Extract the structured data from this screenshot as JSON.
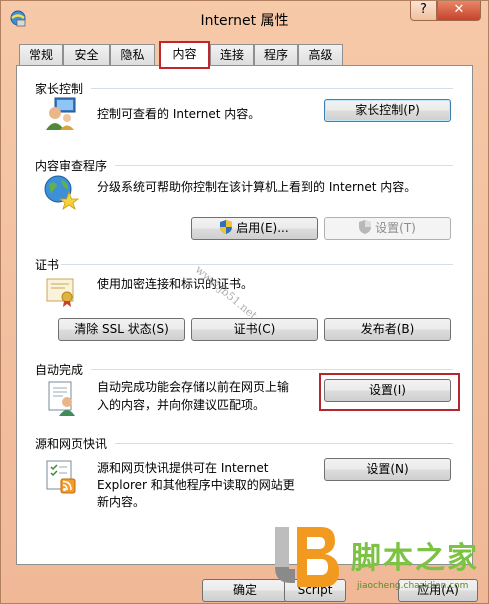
{
  "window": {
    "title": "Internet 属性",
    "help_label": "?",
    "close_label": "✕"
  },
  "tabs": [
    {
      "label": "常规"
    },
    {
      "label": "安全"
    },
    {
      "label": "隐私"
    },
    {
      "label": "内容",
      "active": true
    },
    {
      "label": "连接"
    },
    {
      "label": "程序"
    },
    {
      "label": "高级"
    }
  ],
  "parental": {
    "title": "家长控制",
    "desc": "控制可查看的 Internet 内容。",
    "button": "家长控制(P)"
  },
  "advisor": {
    "title": "内容审查程序",
    "desc": "分级系统可帮助你控制在该计算机上看到的 Internet 内容。",
    "enable_button": "启用(E)...",
    "settings_button": "设置(T)"
  },
  "certificates": {
    "title": "证书",
    "desc": "使用加密连接和标识的证书。",
    "clear_ssl_button": "清除 SSL 状态(S)",
    "cert_button": "证书(C)",
    "publishers_button": "发布者(B)"
  },
  "autocomplete": {
    "title": "自动完成",
    "desc_line1": "自动完成功能会存储以前在网页上输",
    "desc_line2": "入的内容，并向你建议匹配项。",
    "button": "设置(I)"
  },
  "feeds": {
    "title": "源和网页快讯",
    "desc_line1": "源和网页快讯提供可在 Internet",
    "desc_line2": "Explorer 和其他程序中读取的网站更",
    "desc_line3": "新内容。",
    "button": "设置(N)"
  },
  "footer": {
    "ok_button": "确定",
    "cancel_fragment": "Script",
    "apply_fragment": "应用(A)"
  },
  "watermark": {
    "text": "www.jb51.net"
  },
  "logo": {
    "text": "脚本之家",
    "url": "jiaocheng.chazidian.com"
  }
}
